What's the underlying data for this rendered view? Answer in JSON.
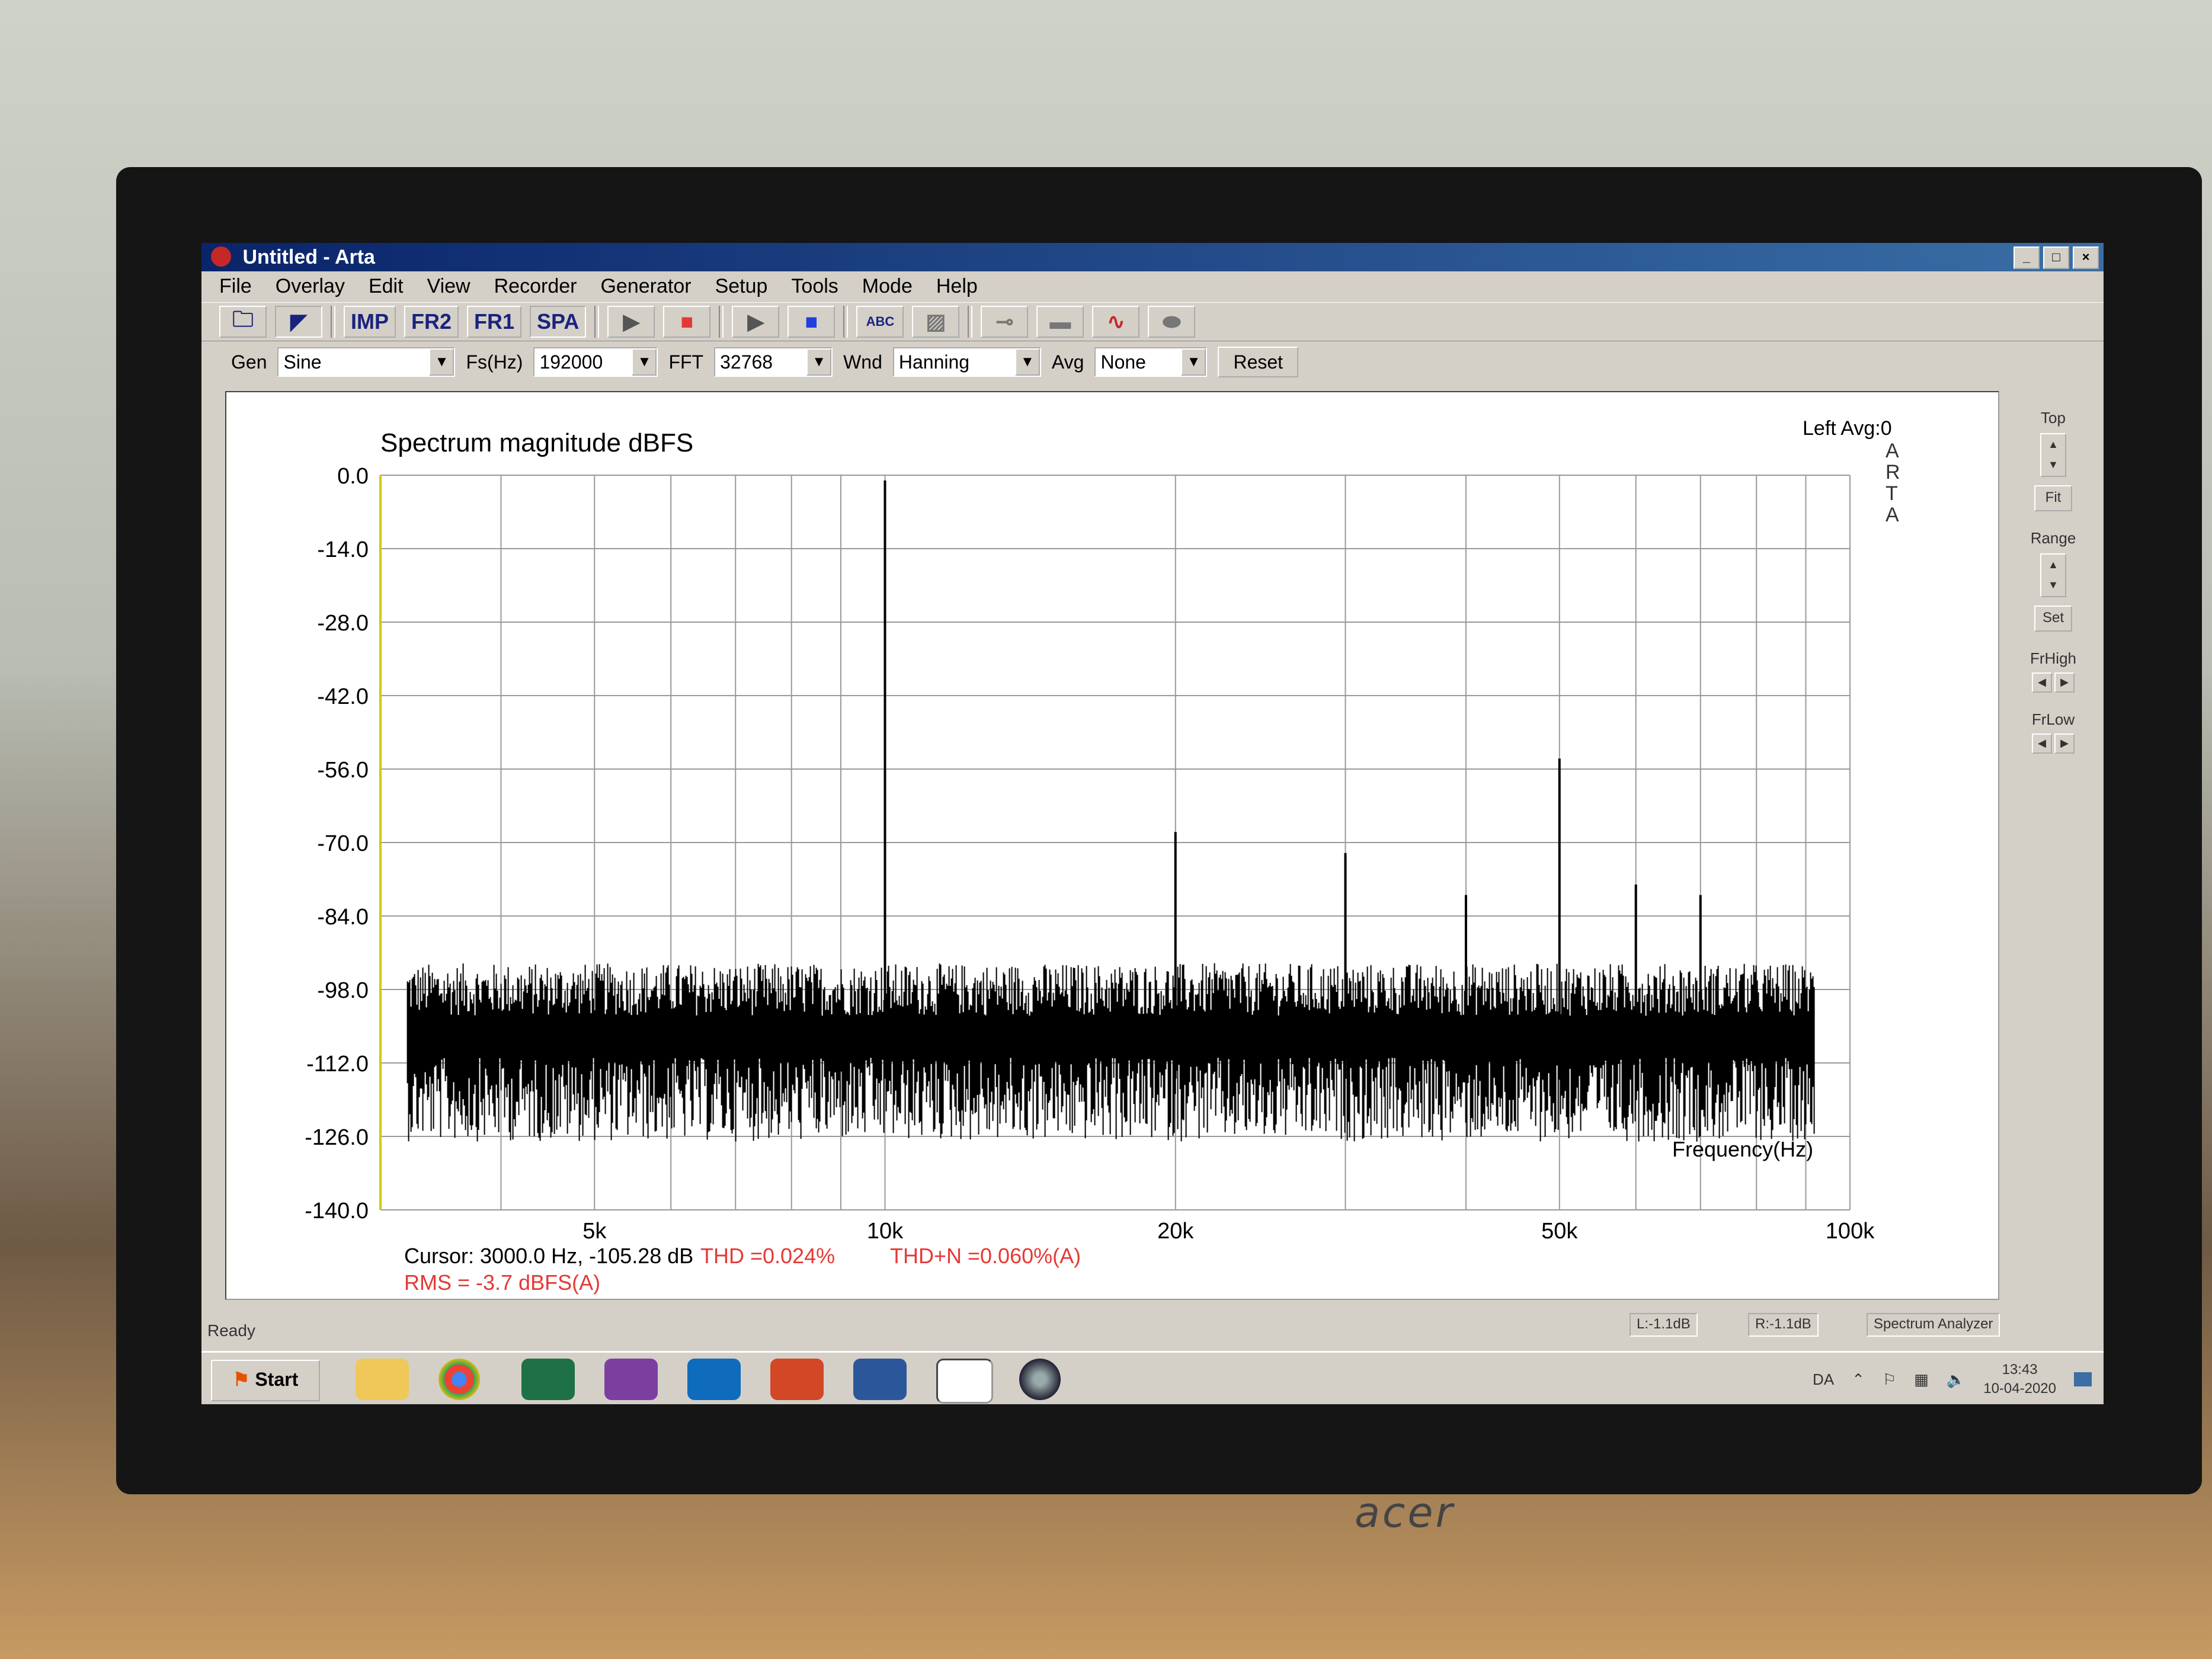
{
  "window": {
    "title": "Untitled - Arta",
    "min": "_",
    "max": "□",
    "close": "×"
  },
  "menu": [
    "File",
    "Overlay",
    "Edit",
    "View",
    "Recorder",
    "Generator",
    "Setup",
    "Tools",
    "Mode",
    "Help"
  ],
  "toolbar": {
    "imp": "IMP",
    "fr2": "FR2",
    "fr1": "FR1",
    "spa": "SPA",
    "abc": "ABC"
  },
  "controls": {
    "gen_label": "Gen",
    "gen_value": "Sine",
    "fs_label": "Fs(Hz)",
    "fs_value": "192000",
    "fft_label": "FFT",
    "fft_value": "32768",
    "wnd_label": "Wnd",
    "wnd_value": "Hanning",
    "avg_label": "Avg",
    "avg_value": "None",
    "reset": "Reset"
  },
  "right_panel": {
    "top": "Top",
    "fit": "Fit",
    "range": "Range",
    "set": "Set",
    "frhigh": "FrHigh",
    "frlow": "FrLow"
  },
  "plot": {
    "title": "Spectrum magnitude dBFS",
    "channel_avg": "Left  Avg:0",
    "logo": [
      "A",
      "R",
      "T",
      "A"
    ],
    "xlabel": "Frequency(Hz)",
    "cursor": "Cursor:  3000.0 Hz, -105.28 dB",
    "rms": "RMS =   -3.7 dBFS(A)",
    "thd": "THD =0.024%",
    "thdn": "THD+N =0.060%(A)"
  },
  "chart_data": {
    "type": "line",
    "title": "Spectrum magnitude dBFS",
    "xlabel": "Frequency(Hz)",
    "ylabel": "",
    "x_scale": "log",
    "xlim": [
      3000,
      100000
    ],
    "ylim": [
      -140,
      0
    ],
    "yticks": [
      "0.0",
      "-14.0",
      "-28.0",
      "-42.0",
      "-56.0",
      "-70.0",
      "-84.0",
      "-98.0",
      "-112.0",
      "-126.0",
      "-140.0"
    ],
    "xticks": [
      {
        "value": 5000,
        "label": "5k"
      },
      {
        "value": 10000,
        "label": "10k"
      },
      {
        "value": 20000,
        "label": "20k"
      },
      {
        "value": 50000,
        "label": "50k"
      },
      {
        "value": 100000,
        "label": "100k"
      }
    ],
    "grid": true,
    "noise_floor_db": -105,
    "peaks": [
      {
        "freq": 10000,
        "db": -1
      },
      {
        "freq": 20000,
        "db": -68
      },
      {
        "freq": 30000,
        "db": -72
      },
      {
        "freq": 40000,
        "db": -80
      },
      {
        "freq": 50000,
        "db": -54
      },
      {
        "freq": 60000,
        "db": -78
      },
      {
        "freq": 70000,
        "db": -80
      }
    ]
  },
  "status": {
    "ready": "Ready",
    "left_level": "L:-1.1dB",
    "right_level": "R:-1.1dB",
    "mode": "Spectrum Analyzer"
  },
  "taskbar": {
    "start": "Start",
    "lang": "DA",
    "time": "13:43",
    "date": "10-04-2020"
  },
  "bezel": {
    "brand": "acer"
  }
}
